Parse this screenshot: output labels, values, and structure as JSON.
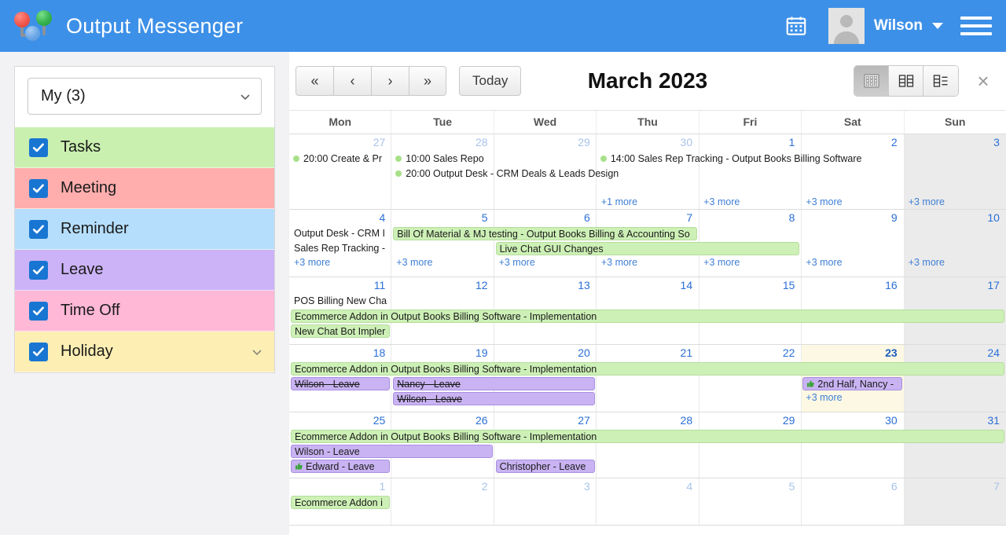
{
  "header": {
    "app_title": "Output Messenger",
    "calendar_icon": "calendar-icon",
    "user_name": "Wilson",
    "menu_icon": "hamburger-menu-icon"
  },
  "sidebar": {
    "calendar_select": {
      "value": "My (3)",
      "chevron": "chevron-down-icon"
    },
    "categories": [
      {
        "label": "Tasks",
        "color": "#caf0b0",
        "checked": true,
        "expandable": false
      },
      {
        "label": "Meeting",
        "color": "#ffadad",
        "checked": true,
        "expandable": false
      },
      {
        "label": "Reminder",
        "color": "#b5defc",
        "checked": true,
        "expandable": false
      },
      {
        "label": "Leave",
        "color": "#ccb3f7",
        "checked": true,
        "expandable": false
      },
      {
        "label": "Time Off",
        "color": "#ffb8d6",
        "checked": true,
        "expandable": false
      },
      {
        "label": "Holiday",
        "color": "#fdeeb3",
        "checked": true,
        "expandable": true
      }
    ]
  },
  "toolbar": {
    "nav": [
      {
        "label": "«",
        "name": "prev-year-button"
      },
      {
        "label": "‹",
        "name": "prev-month-button"
      },
      {
        "label": "›",
        "name": "next-month-button"
      },
      {
        "label": "»",
        "name": "next-year-button"
      }
    ],
    "today_label": "Today",
    "period_title": "March 2023",
    "views": [
      {
        "name": "month-view-button",
        "icon": "grid-view-icon",
        "active": true
      },
      {
        "name": "week-view-button",
        "icon": "column-view-icon",
        "active": false
      },
      {
        "name": "list-view-button",
        "icon": "list-view-icon",
        "active": false
      }
    ],
    "close_label": "×"
  },
  "calendar": {
    "day_names": [
      "Mon",
      "Tue",
      "Wed",
      "Thu",
      "Fri",
      "Sat",
      "Sun"
    ],
    "weeks": [
      {
        "days": [
          {
            "num": "27",
            "other": true
          },
          {
            "num": "28",
            "other": true
          },
          {
            "num": "29",
            "other": true
          },
          {
            "num": "30",
            "other": true
          },
          {
            "num": "1"
          },
          {
            "num": "2"
          },
          {
            "num": "3",
            "weekend": true
          }
        ],
        "events": [
          {
            "text": "20:00 Create & Pr",
            "style": "dot",
            "start": 0,
            "span": 1,
            "row": 0
          },
          {
            "text": "10:00 Sales Repo",
            "style": "dot",
            "start": 1,
            "span": 1,
            "row": 0
          },
          {
            "text": "14:00 Sales Rep Tracking - Output Books Billing Software",
            "style": "dot",
            "start": 3,
            "span": 4,
            "row": 0
          },
          {
            "text": "20:00 Output Desk - CRM Deals & Leads Design",
            "style": "dot",
            "start": 1,
            "span": 3,
            "row": 1
          }
        ],
        "more": [
          {
            "text": "+1 more",
            "col": 3
          },
          {
            "text": "+3 more",
            "col": 4
          },
          {
            "text": "+3 more",
            "col": 5
          },
          {
            "text": "+3 more",
            "col": 6
          }
        ]
      },
      {
        "days": [
          {
            "num": "4"
          },
          {
            "num": "5"
          },
          {
            "num": "6"
          },
          {
            "num": "7"
          },
          {
            "num": "8"
          },
          {
            "num": "9"
          },
          {
            "num": "10",
            "weekend": true
          }
        ],
        "events": [
          {
            "text": "Output Desk - CRM I",
            "style": "plain",
            "start": 0,
            "span": 1,
            "row": 0
          },
          {
            "text": "Bill Of Material & MJ testing - Output Books Billing & Accounting So",
            "style": "tasks",
            "start": 1,
            "span": 3,
            "row": 0
          },
          {
            "text": "Sales Rep Tracking - ",
            "style": "plain",
            "start": 0,
            "span": 1,
            "row": 1
          },
          {
            "text": "Live Chat GUI Changes",
            "style": "tasks",
            "start": 2,
            "span": 3,
            "row": 1
          }
        ],
        "more": [
          {
            "text": "+3 more",
            "col": 0
          },
          {
            "text": "+3 more",
            "col": 1
          },
          {
            "text": "+3 more",
            "col": 2
          },
          {
            "text": "+3 more",
            "col": 3
          },
          {
            "text": "+3 more",
            "col": 4
          },
          {
            "text": "+3 more",
            "col": 5
          },
          {
            "text": "+3 more",
            "col": 6
          }
        ]
      },
      {
        "days": [
          {
            "num": "11"
          },
          {
            "num": "12"
          },
          {
            "num": "13"
          },
          {
            "num": "14"
          },
          {
            "num": "15"
          },
          {
            "num": "16"
          },
          {
            "num": "17",
            "weekend": true
          }
        ],
        "events": [
          {
            "text": "POS Billing New Cha",
            "style": "plain",
            "start": 0,
            "span": 1,
            "row": 0
          },
          {
            "text": "Ecommerce Addon in Output Books Billing Software - Implementation",
            "style": "tasks",
            "start": 0,
            "span": 7,
            "row": 1
          },
          {
            "text": "New Chat Bot Impler",
            "style": "tasks",
            "start": 0,
            "span": 1,
            "row": 2
          }
        ],
        "more": []
      },
      {
        "days": [
          {
            "num": "18"
          },
          {
            "num": "19"
          },
          {
            "num": "20"
          },
          {
            "num": "21"
          },
          {
            "num": "22"
          },
          {
            "num": "23",
            "today": true
          },
          {
            "num": "24",
            "weekend": true
          }
        ],
        "events": [
          {
            "text": "Ecommerce Addon in Output Books Billing Software - Implementation",
            "style": "tasks",
            "start": 0,
            "span": 7,
            "row": 0
          },
          {
            "text": "Wilson - Leave",
            "style": "leave",
            "strike": true,
            "start": 0,
            "span": 1,
            "row": 1
          },
          {
            "text": "Nancy - Leave",
            "style": "leave",
            "strike": true,
            "start": 1,
            "span": 2,
            "row": 1
          },
          {
            "text": "2nd Half, Nancy - ",
            "style": "leave",
            "thumb": true,
            "start": 5,
            "span": 1,
            "row": 1
          },
          {
            "text": "Wilson - Leave",
            "style": "leave",
            "strike": true,
            "start": 1,
            "span": 2,
            "row": 2
          }
        ],
        "more": [
          {
            "text": "+3 more",
            "col": 5,
            "row": 2
          }
        ]
      },
      {
        "days": [
          {
            "num": "25"
          },
          {
            "num": "26"
          },
          {
            "num": "27"
          },
          {
            "num": "28"
          },
          {
            "num": "29"
          },
          {
            "num": "30"
          },
          {
            "num": "31",
            "weekend": true
          }
        ],
        "events": [
          {
            "text": "Ecommerce Addon in Output Books Billing Software - Implementation",
            "style": "tasks",
            "start": 0,
            "span": 7,
            "row": 0
          },
          {
            "text": "Wilson - Leave",
            "style": "leave",
            "start": 0,
            "span": 2,
            "row": 1
          },
          {
            "text": "Edward - Leave",
            "style": "leave",
            "thumb": true,
            "start": 0,
            "span": 1,
            "row": 2
          },
          {
            "text": "Christopher - Leave",
            "style": "leave",
            "start": 2,
            "span": 1,
            "row": 2
          }
        ],
        "more": []
      },
      {
        "days": [
          {
            "num": "1",
            "other": true
          },
          {
            "num": "2",
            "other": true
          },
          {
            "num": "3",
            "other": true
          },
          {
            "num": "4",
            "other": true
          },
          {
            "num": "5",
            "other": true
          },
          {
            "num": "6",
            "other": true
          },
          {
            "num": "7",
            "other": true,
            "weekend": true
          }
        ],
        "events": [
          {
            "text": "Ecommerce Addon i",
            "style": "tasks",
            "start": 0,
            "span": 1,
            "row": 0
          }
        ],
        "more": []
      }
    ]
  }
}
